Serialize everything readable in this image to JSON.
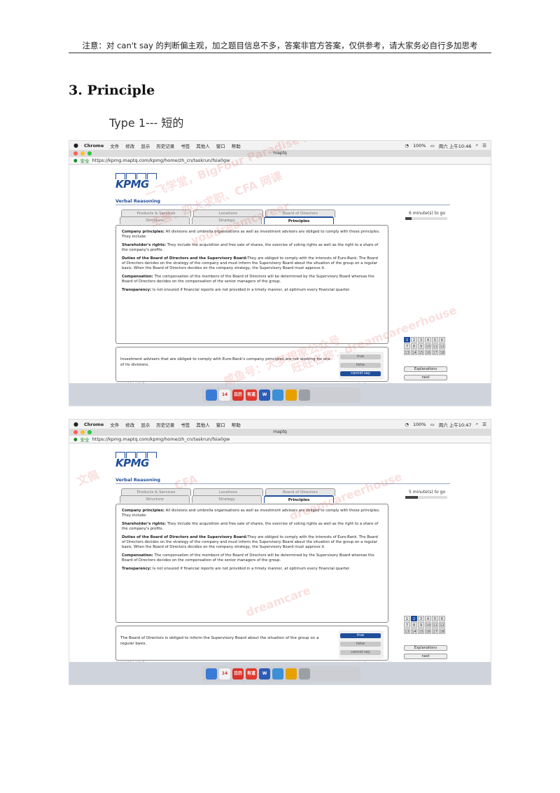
{
  "header": {
    "note": "注意：对 can't say 的判断偏主观，加之题目信息不多，答案非官方答案，仅供参考，请大家务必自行多加思考"
  },
  "section": {
    "title": "3. Principle",
    "type_label": "Type 1---  短的"
  },
  "screenshots": [
    {
      "menubar": {
        "app": "Chrome",
        "items": [
          "文件",
          "修改",
          "显示",
          "历史记录",
          "书签",
          "其他人",
          "窗口",
          "帮助"
        ],
        "battery": "100%",
        "clock": "周六 上午10:46"
      },
      "window_title": "maptq",
      "url": {
        "secure_label": "安全",
        "address": "https://kpmg.maptq.com/kpmg/home/zh_cn/taskrun/fsia0gw"
      },
      "logo_text": "KPMG",
      "section_label": "Verbal Reasoning",
      "tabs_back": [
        "Products & Services",
        "Locations",
        "Board of Directors"
      ],
      "tabs_front": [
        "Structure",
        "Strategy",
        "Principles"
      ],
      "active_tab": "Principles",
      "timer": "6 minute(s) to go",
      "timer_fraction": 0.15,
      "passage": [
        {
          "label": "Company principles:",
          "text": " All divisions and umbrella organisations as well as investment advisors are obliged to comply with these principles. They include:"
        },
        {
          "label": "Shareholder's rights:",
          "text": " They include the acquisition and free sale of shares, the exercise of voting rights as well as the right to a share of the company's profits."
        },
        {
          "label": "Duties of the Board of Directors and the Supervisory Board:",
          "text": "They are obliged to comply with the interests of Euro-Bank. The Board of Directors decides on the strategy of the company and must inform the Supervisory Board about the situation of the group on a regular basis. When the Board of Directors decides on the company strategy, the Supervisory Board must approve it."
        },
        {
          "label": "Compensation:",
          "text": " The compensation of the members of the Board of Directors will be determined by the Supervisory Board whereas the Board of Directors decides on the compensation of the senior managers of the group."
        },
        {
          "label": "Transparency:",
          "text": " Is not ensured if financial reports are not provided in a timely manner, at optimum every financial quarter."
        }
      ],
      "numbers": [
        "1",
        "2",
        "3",
        "4",
        "5",
        "6",
        "7",
        "8",
        "9",
        "10",
        "11",
        "12",
        "13",
        "14",
        "15",
        "16",
        "17",
        "18"
      ],
      "current_number": "1",
      "side_buttons": {
        "explanations": "Explanations",
        "next": "next"
      },
      "question": "Investment advisers that are obliged to comply with Euro-Bank's company principles are not working for one of its divisions.",
      "answers": [
        "true",
        "false",
        "cannot say"
      ],
      "selected_answer": "cannot say",
      "powered_by": "powered by cute®",
      "credit": "social skills, Florian company 3.0",
      "watermarks": [
        "一飞学堂，BigFour Paradise 网店",
        "主营：四大求职、CFA 网课",
        "youdreamcareer",
        "咸鱼号：大梦想家公众号",
        "旺旺名称：dreamcareerhouse"
      ],
      "dock": [
        "",
        "14",
        "日历",
        "有道",
        "W",
        "",
        "",
        ""
      ]
    },
    {
      "menubar": {
        "app": "Chrome",
        "items": [
          "文件",
          "修改",
          "显示",
          "历史记录",
          "书签",
          "其他人",
          "窗口",
          "帮助"
        ],
        "battery": "100%",
        "clock": "周六 上午10:47"
      },
      "window_title": "maptq",
      "url": {
        "secure_label": "安全",
        "address": "https://kpmg.maptq.com/kpmg/home/zh_cn/taskrun/fsia0gw"
      },
      "logo_text": "KPMG",
      "section_label": "Verbal Reasoning",
      "tabs_back": [
        "Products & Services",
        "Locations",
        "Board of Directors"
      ],
      "tabs_front": [
        "Structure",
        "Strategy",
        "Principles"
      ],
      "active_tab": "Principles",
      "timer": "5 minute(s) to go",
      "timer_fraction": 0.3,
      "passage": [
        {
          "label": "Company principles:",
          "text": " All divisions and umbrella organisations as well as investment advisors are obliged to comply with these principles. They include:"
        },
        {
          "label": "Shareholder's rights:",
          "text": " They include the acquisition and free sale of shares, the exercise of voting rights as well as the right to a share of the company's profits."
        },
        {
          "label": "Duties of the Board of Directors and the Supervisory Board:",
          "text": "They are obliged to comply with the interests of Euro-Bank. The Board of Directors decides on the strategy of the company and must inform the Supervisory Board about the situation of the group on a regular basis. When the Board of Directors decides on the company strategy, the Supervisory Board must approve it."
        },
        {
          "label": "Compensation:",
          "text": " The compensation of the members of the Board of Directors will be determined by the Supervisory Board whereas the Board of Directors decides on the compensation of the senior managers of the group."
        },
        {
          "label": "Transparency:",
          "text": " Is not ensured if financial reports are not provided in a timely manner, at optimum every financial quarter."
        }
      ],
      "numbers": [
        "1",
        "2",
        "3",
        "4",
        "5",
        "6",
        "7",
        "8",
        "9",
        "10",
        "11",
        "12",
        "13",
        "14",
        "15",
        "16",
        "17",
        "18"
      ],
      "current_number": "2",
      "side_buttons": {
        "explanations": "Explanations",
        "next": "next"
      },
      "question": "The Board of Directors is obliged to inform the Supervisory Board about the situation of the group on a regular basis.",
      "answers": [
        "true",
        "false",
        "cannot say"
      ],
      "selected_answer": "true",
      "powered_by": "powered by cute®",
      "credit": "social skills, Florian company 3.0",
      "watermarks": [
        "文佩",
        "CFA",
        "dreamcareerhouse",
        "dreamcare"
      ],
      "dock": [
        "",
        "14",
        "日历",
        "有道",
        "W",
        "",
        "",
        ""
      ]
    }
  ],
  "colors": {
    "accent": "#1f4e9a",
    "watermark": "#dc5046"
  }
}
